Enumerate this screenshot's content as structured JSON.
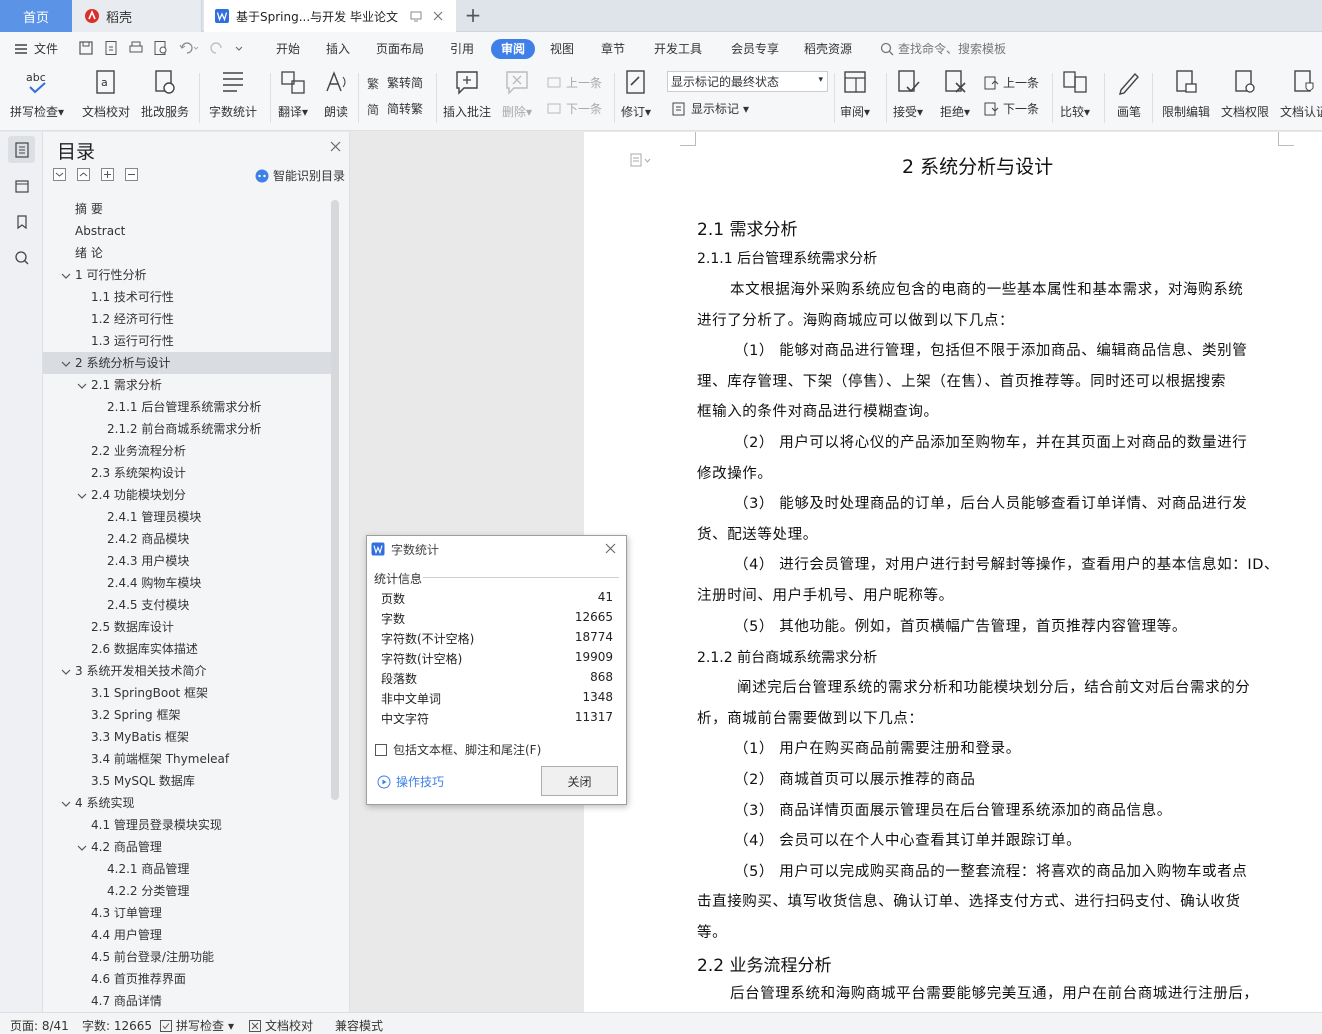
{
  "tabs": {
    "home": "首页",
    "straw": "稻壳",
    "doc_title": "基于Spring...与开发 毕业论文"
  },
  "menu": {
    "file": "文件",
    "items": [
      "开始",
      "插入",
      "页面布局",
      "引用",
      "审阅",
      "视图",
      "章节",
      "开发工具",
      "会员专享",
      "稻壳资源"
    ],
    "active": "审阅",
    "search": "查找命令、搜索模板"
  },
  "ribbon": {
    "spell": "拼写检查",
    "proof": "文档校对",
    "annot_service": "批改服务",
    "wordcount": "字数统计",
    "translate": "翻译",
    "read": "朗读",
    "trad": "繁转简",
    "simp": "简转繁",
    "insert_comment": "插入批注",
    "delete": "删除",
    "prev1": "上一条",
    "next1": "下一条",
    "revise": "修订",
    "mode_select": "显示标记的最终状态",
    "show_marks": "显示标记",
    "review": "审阅",
    "accept": "接受",
    "reject": "拒绝",
    "prev2": "上一条",
    "next2": "下一条",
    "compare": "比较",
    "pen": "画笔",
    "limit_edit": "限制编辑",
    "doc_rights": "文档权限",
    "doc_cert": "文档认证"
  },
  "outline": {
    "title": "目录",
    "smart": "智能识别目录",
    "items": [
      {
        "text": "摘  要",
        "level": 0
      },
      {
        "text": "Abstract",
        "level": 0
      },
      {
        "text": "绪  论",
        "level": 0
      },
      {
        "text": "1  可行性分析",
        "level": 1
      },
      {
        "text": "1.1  技术可行性",
        "level": 2
      },
      {
        "text": "1.2  经济可行性",
        "level": 2
      },
      {
        "text": "1.3  运行可行性",
        "level": 2
      },
      {
        "text": "2  系统分析与设计",
        "level": 1
      },
      {
        "text": "2.1  需求分析",
        "level": 2
      },
      {
        "text": "2.1.1  后台管理系统需求分析",
        "level": 3
      },
      {
        "text": "2.1.2  前台商城系统需求分析",
        "level": 3
      },
      {
        "text": "2.2  业务流程分析",
        "level": 2
      },
      {
        "text": "2.3  系统架构设计",
        "level": 2
      },
      {
        "text": "2.4  功能模块划分",
        "level": 2
      },
      {
        "text": "2.4.1  管理员模块",
        "level": 3
      },
      {
        "text": "2.4.2  商品模块",
        "level": 3
      },
      {
        "text": "2.4.3  用户模块",
        "level": 3
      },
      {
        "text": "2.4.4  购物车模块",
        "level": 3
      },
      {
        "text": "2.4.5  支付模块",
        "level": 3
      },
      {
        "text": "2.5  数据库设计",
        "level": 2
      },
      {
        "text": "2.6  数据库实体描述",
        "level": 2
      },
      {
        "text": "3  系统开发相关技术简介",
        "level": 1
      },
      {
        "text": "3.1 SpringBoot 框架",
        "level": 2
      },
      {
        "text": "3.2 Spring 框架",
        "level": 2
      },
      {
        "text": "3.3 MyBatis 框架",
        "level": 2
      },
      {
        "text": "3.4 前端框架 Thymeleaf",
        "level": 2
      },
      {
        "text": "3.5 MySQL 数据库",
        "level": 2
      },
      {
        "text": "4  系统实现",
        "level": 1
      },
      {
        "text": "4.1  管理员登录模块实现",
        "level": 2
      },
      {
        "text": "4.2  商品管理",
        "level": 2
      },
      {
        "text": "4.2.1  商品管理",
        "level": 3
      },
      {
        "text": "4.2.2  分类管理",
        "level": 3
      },
      {
        "text": "4.3  订单管理",
        "level": 2
      },
      {
        "text": "4.4  用户管理",
        "level": 2
      },
      {
        "text": "4.5  前台登录/注册功能",
        "level": 2
      },
      {
        "text": "4.6  首页推荐界面",
        "level": 2
      },
      {
        "text": "4.7  商品详情",
        "level": 2
      }
    ]
  },
  "document": {
    "lines": [
      {
        "text": "2  系统分析与设计",
        "cls": "h1"
      },
      {
        "text": "2.1  需求分析",
        "cls": "h2"
      },
      {
        "text": "2.1.1  后台管理系统需求分析",
        "cls": "h3"
      },
      {
        "text": "本文根据海外采购系统应包含的电商的一些基本属性和基本需求，对海购系统",
        "cls": "p"
      },
      {
        "text": "进行了分析了。海购商城应可以做到以下几点：",
        "cls": "p"
      },
      {
        "text": "（1）  能够对商品进行管理，包括但不限于添加商品、编辑商品信息、类别管",
        "cls": "p"
      },
      {
        "text": "理、库存管理、下架（停售）、上架（在售）、首页推荐等。同时还可以根据搜索",
        "cls": "p"
      },
      {
        "text": "框输入的条件对商品进行模糊查询。",
        "cls": "p"
      },
      {
        "text": "（2）  用户可以将心仪的产品添加至购物车，并在其页面上对商品的数量进行",
        "cls": "p"
      },
      {
        "text": "修改操作。",
        "cls": "p"
      },
      {
        "text": "（3）  能够及时处理商品的订单，后台人员能够查看订单详情、对商品进行发",
        "cls": "p"
      },
      {
        "text": "货、配送等处理。",
        "cls": "p"
      },
      {
        "text": "（4）  进行会员管理，对用户进行封号解封等操作，查看用户的基本信息如：ID、",
        "cls": "p"
      },
      {
        "text": "注册时间、用户手机号、用户昵称等。",
        "cls": "p"
      },
      {
        "text": "（5）  其他功能。例如，首页横幅广告管理，首页推荐内容管理等。",
        "cls": "p"
      },
      {
        "text": "2.1.2  前台商城系统需求分析",
        "cls": "h3"
      },
      {
        "text": "阐述完后台管理系统的需求分析和功能模块划分后，结合前文对后台需求的分",
        "cls": "p"
      },
      {
        "text": "析，商城前台需要做到以下几点：",
        "cls": "p"
      },
      {
        "text": "（1）  用户在购买商品前需要注册和登录。",
        "cls": "p"
      },
      {
        "text": "（2）  商城首页可以展示推荐的商品",
        "cls": "p"
      },
      {
        "text": "（3）  商品详情页面展示管理员在后台管理系统添加的商品信息。",
        "cls": "p"
      },
      {
        "text": "（4）  会员可以在个人中心查看其订单并跟踪订单。",
        "cls": "p"
      },
      {
        "text": "（5）  用户可以完成购买商品的一整套流程：将喜欢的商品加入购物车或者点",
        "cls": "p"
      },
      {
        "text": "击直接购买、填写收货信息、确认订单、选择支付方式、进行扫码支付、确认收货",
        "cls": "p"
      },
      {
        "text": "等。",
        "cls": "p"
      },
      {
        "text": "2.2  业务流程分析",
        "cls": "h2"
      },
      {
        "text": "后台管理系统和海购商城平台需要能够完美互通，用户在前台商城进行注册后，",
        "cls": "p"
      }
    ]
  },
  "dialog": {
    "title": "字数统计",
    "group": "统计信息",
    "rows": [
      {
        "label": "页数",
        "value": "41"
      },
      {
        "label": "字数",
        "value": "12665"
      },
      {
        "label": "字符数(不计空格)",
        "value": "18774"
      },
      {
        "label": "字符数(计空格)",
        "value": "19909"
      },
      {
        "label": "段落数",
        "value": "868"
      },
      {
        "label": "非中文单词",
        "value": "1348"
      },
      {
        "label": "中文字符",
        "value": "11317"
      }
    ],
    "checkbox": "包括文本框、脚注和尾注(F)",
    "tips": "操作技巧",
    "close": "关闭"
  },
  "status": {
    "page": "页面: 8/41",
    "words": "字数: 12665",
    "spell": "拼写检查",
    "proof": "文档校对",
    "compat": "兼容模式"
  },
  "colors": {
    "accent": "#3f7fe8",
    "home_tab": "#5b93e6"
  }
}
